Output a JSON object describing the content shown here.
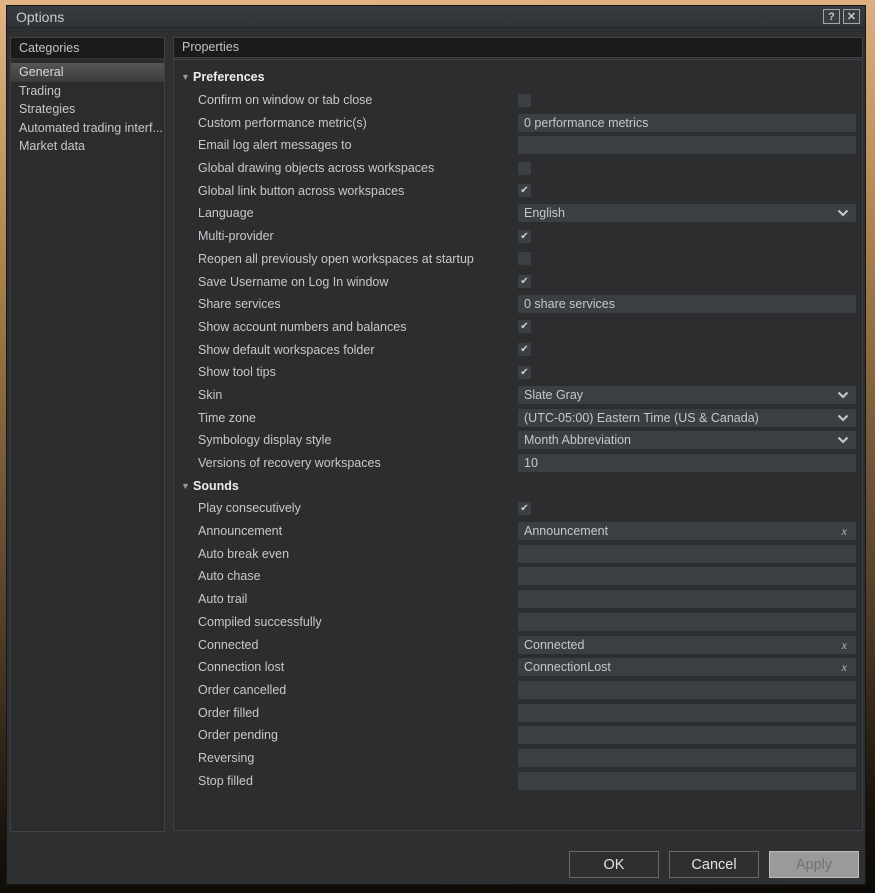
{
  "window": {
    "title": "Options"
  },
  "icons": {
    "help_glyph": "?",
    "close_glyph": "✕",
    "section_collapse_glyph": "▼",
    "check_glyph": "✔",
    "clear_glyph": "x"
  },
  "categories": {
    "header": "Categories",
    "items": [
      {
        "label": "General",
        "selected": true
      },
      {
        "label": "Trading",
        "selected": false
      },
      {
        "label": "Strategies",
        "selected": false
      },
      {
        "label": "Automated trading interf...",
        "selected": false
      },
      {
        "label": "Market data",
        "selected": false
      }
    ]
  },
  "properties": {
    "header": "Properties",
    "sections": [
      {
        "title": "Preferences",
        "rows": [
          {
            "label": "Confirm on window or tab close",
            "type": "checkbox",
            "checked": false
          },
          {
            "label": "Custom performance metric(s)",
            "type": "text",
            "value": "0 performance metrics"
          },
          {
            "label": "Email log alert messages to",
            "type": "text",
            "value": ""
          },
          {
            "label": "Global drawing objects across workspaces",
            "type": "checkbox",
            "checked": false
          },
          {
            "label": "Global link button across workspaces",
            "type": "checkbox",
            "checked": true
          },
          {
            "label": "Language",
            "type": "select",
            "value": "English"
          },
          {
            "label": "Multi-provider",
            "type": "checkbox",
            "checked": true
          },
          {
            "label": "Reopen all previously open workspaces at startup",
            "type": "checkbox",
            "checked": false
          },
          {
            "label": "Save Username on Log In window",
            "type": "checkbox",
            "checked": true
          },
          {
            "label": "Share services",
            "type": "text",
            "value": "0 share services"
          },
          {
            "label": "Show account numbers and balances",
            "type": "checkbox",
            "checked": true
          },
          {
            "label": "Show default workspaces folder",
            "type": "checkbox",
            "checked": true
          },
          {
            "label": "Show tool tips",
            "type": "checkbox",
            "checked": true
          },
          {
            "label": "Skin",
            "type": "select",
            "value": "Slate Gray"
          },
          {
            "label": "Time zone",
            "type": "select",
            "value": "(UTC-05:00) Eastern Time (US & Canada)"
          },
          {
            "label": "Symbology display style",
            "type": "select",
            "value": "Month Abbreviation"
          },
          {
            "label": "Versions of recovery workspaces",
            "type": "text",
            "value": "10"
          }
        ]
      },
      {
        "title": "Sounds",
        "rows": [
          {
            "label": "Play consecutively",
            "type": "checkbox",
            "checked": true
          },
          {
            "label": "Announcement",
            "type": "sound",
            "value": "Announcement"
          },
          {
            "label": "Auto break even",
            "type": "sound",
            "value": ""
          },
          {
            "label": "Auto chase",
            "type": "sound",
            "value": ""
          },
          {
            "label": "Auto trail",
            "type": "sound",
            "value": ""
          },
          {
            "label": "Compiled successfully",
            "type": "sound",
            "value": ""
          },
          {
            "label": "Connected",
            "type": "sound",
            "value": "Connected"
          },
          {
            "label": "Connection lost",
            "type": "sound",
            "value": "ConnectionLost"
          },
          {
            "label": "Order cancelled",
            "type": "sound",
            "value": ""
          },
          {
            "label": "Order filled",
            "type": "sound",
            "value": ""
          },
          {
            "label": "Order pending",
            "type": "sound",
            "value": ""
          },
          {
            "label": "Reversing",
            "type": "sound",
            "value": ""
          },
          {
            "label": "Stop filled",
            "type": "sound",
            "value": ""
          }
        ]
      }
    ]
  },
  "footer": {
    "ok_label": "OK",
    "cancel_label": "Cancel",
    "apply_label": "Apply",
    "apply_enabled": false
  },
  "colors": {
    "dialog_bg": "#2f3031",
    "panel_header_bg": "#1b1b1c",
    "field_bg": "#3b3e42",
    "selected_category_bg": "#4e4e4c",
    "apply_disabled_bg": "#9a9a9a",
    "desktop_top": "#e2b586",
    "desktop_bottom": "#0c0906"
  }
}
